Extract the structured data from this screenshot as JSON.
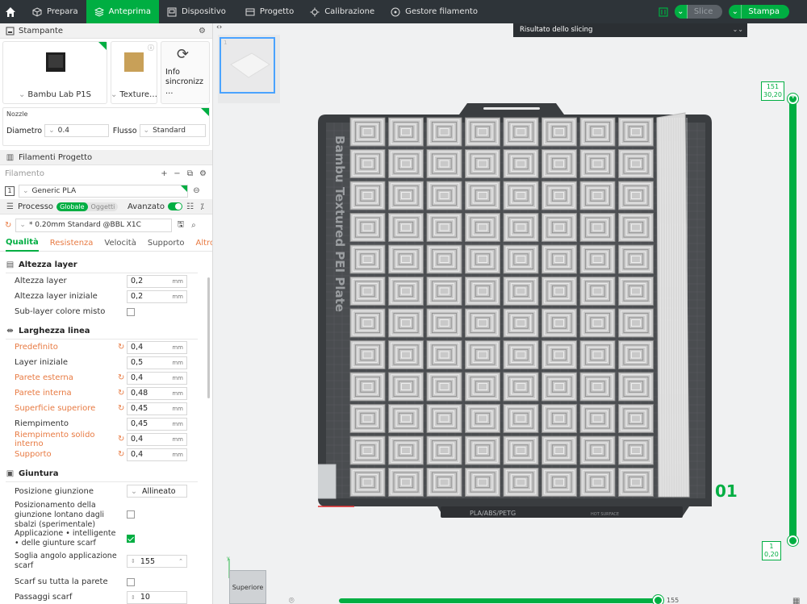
{
  "topbar": {
    "tabs": [
      "Prepara",
      "Anteprima",
      "Dispositivo",
      "Progetto",
      "Calibrazione",
      "Gestore filamento"
    ],
    "active_tab": "Anteprima",
    "slice_label": "Slice",
    "print_label": "Stampa"
  },
  "printer": {
    "header": "Stampante",
    "printer_name": "Bambu Lab P1S",
    "plate_name": "Texture…",
    "sync_label": "Info sincronizz…"
  },
  "nozzle": {
    "title": "Nozzle",
    "diameter_label": "Diametro",
    "diameter_value": "0.4",
    "flow_label": "Flusso",
    "flow_value": "Standard"
  },
  "filaments": {
    "header": "Filamenti Progetto",
    "row_label": "Filamento",
    "slot_number": "1",
    "filament_name": "Generic PLA"
  },
  "process": {
    "header": "Processo",
    "global_label": "Globale",
    "objects_label": "Oggetti",
    "advanced_label": "Avanzato",
    "preset_name": "* 0.20mm Standard @BBL X1C",
    "tabs": [
      "Qualità",
      "Resistenza",
      "Velocità",
      "Supporto",
      "Altro"
    ]
  },
  "groups": {
    "layer_height": {
      "title": "Altezza layer",
      "rows": [
        {
          "label": "Altezza layer",
          "value": "0,2",
          "unit": "mm"
        },
        {
          "label": "Altezza layer iniziale",
          "value": "0,2",
          "unit": "mm"
        },
        {
          "label": "Sub-layer colore misto",
          "checked": false
        }
      ]
    },
    "line_width": {
      "title": "Larghezza linea",
      "rows": [
        {
          "label": "Predefinito",
          "value": "0,4",
          "unit": "mm",
          "modified": true
        },
        {
          "label": "Layer iniziale",
          "value": "0,5",
          "unit": "mm",
          "modified": false
        },
        {
          "label": "Parete esterna",
          "value": "0,4",
          "unit": "mm",
          "modified": true
        },
        {
          "label": "Parete interna",
          "value": "0,48",
          "unit": "mm",
          "modified": true
        },
        {
          "label": "Superficie superiore",
          "value": "0,45",
          "unit": "mm",
          "modified": true
        },
        {
          "label": "Riempimento",
          "value": "0,45",
          "unit": "mm",
          "modified": false
        },
        {
          "label": "Riempimento solido interno",
          "value": "0,4",
          "unit": "mm",
          "modified": true
        },
        {
          "label": "Supporto",
          "value": "0,4",
          "unit": "mm",
          "modified": true
        }
      ]
    },
    "seam": {
      "title": "Giuntura",
      "position_label": "Posizione giunzione",
      "position_value": "Allineato",
      "away_label": "Posizionamento della giunzione lontano dagli sbalzi (sperimentale)",
      "away_checked": false,
      "scarf_label": "Applicazione • intelligente • delle giunture scarf",
      "scarf_checked": true,
      "threshold_label": "Soglia angolo applicazione scarf",
      "threshold_value": "155",
      "entire_wall_label": "Scarf su tutta la parete",
      "entire_wall_checked": false,
      "steps_label": "Passaggi scarf",
      "steps_value": "10"
    }
  },
  "viewport": {
    "slice_result_title": "Risultato dello slicing",
    "plate_text": "Bambu Textured PEI Plate",
    "plate_tag": "PLA/ABS/PETG",
    "plate_tag2": "HOT SURFACE",
    "layer_top_num": "151",
    "layer_top_height": "30,20",
    "layer_bottom_num": "1",
    "layer_bottom_height": "0,20",
    "plate_number": "01",
    "h_slider_value": "155",
    "viewcube_label": "Superiore",
    "thumb_number": "1"
  },
  "colors": {
    "accent": "#00ae42",
    "modified": "#e87a42",
    "topbar": "#2e3439"
  }
}
